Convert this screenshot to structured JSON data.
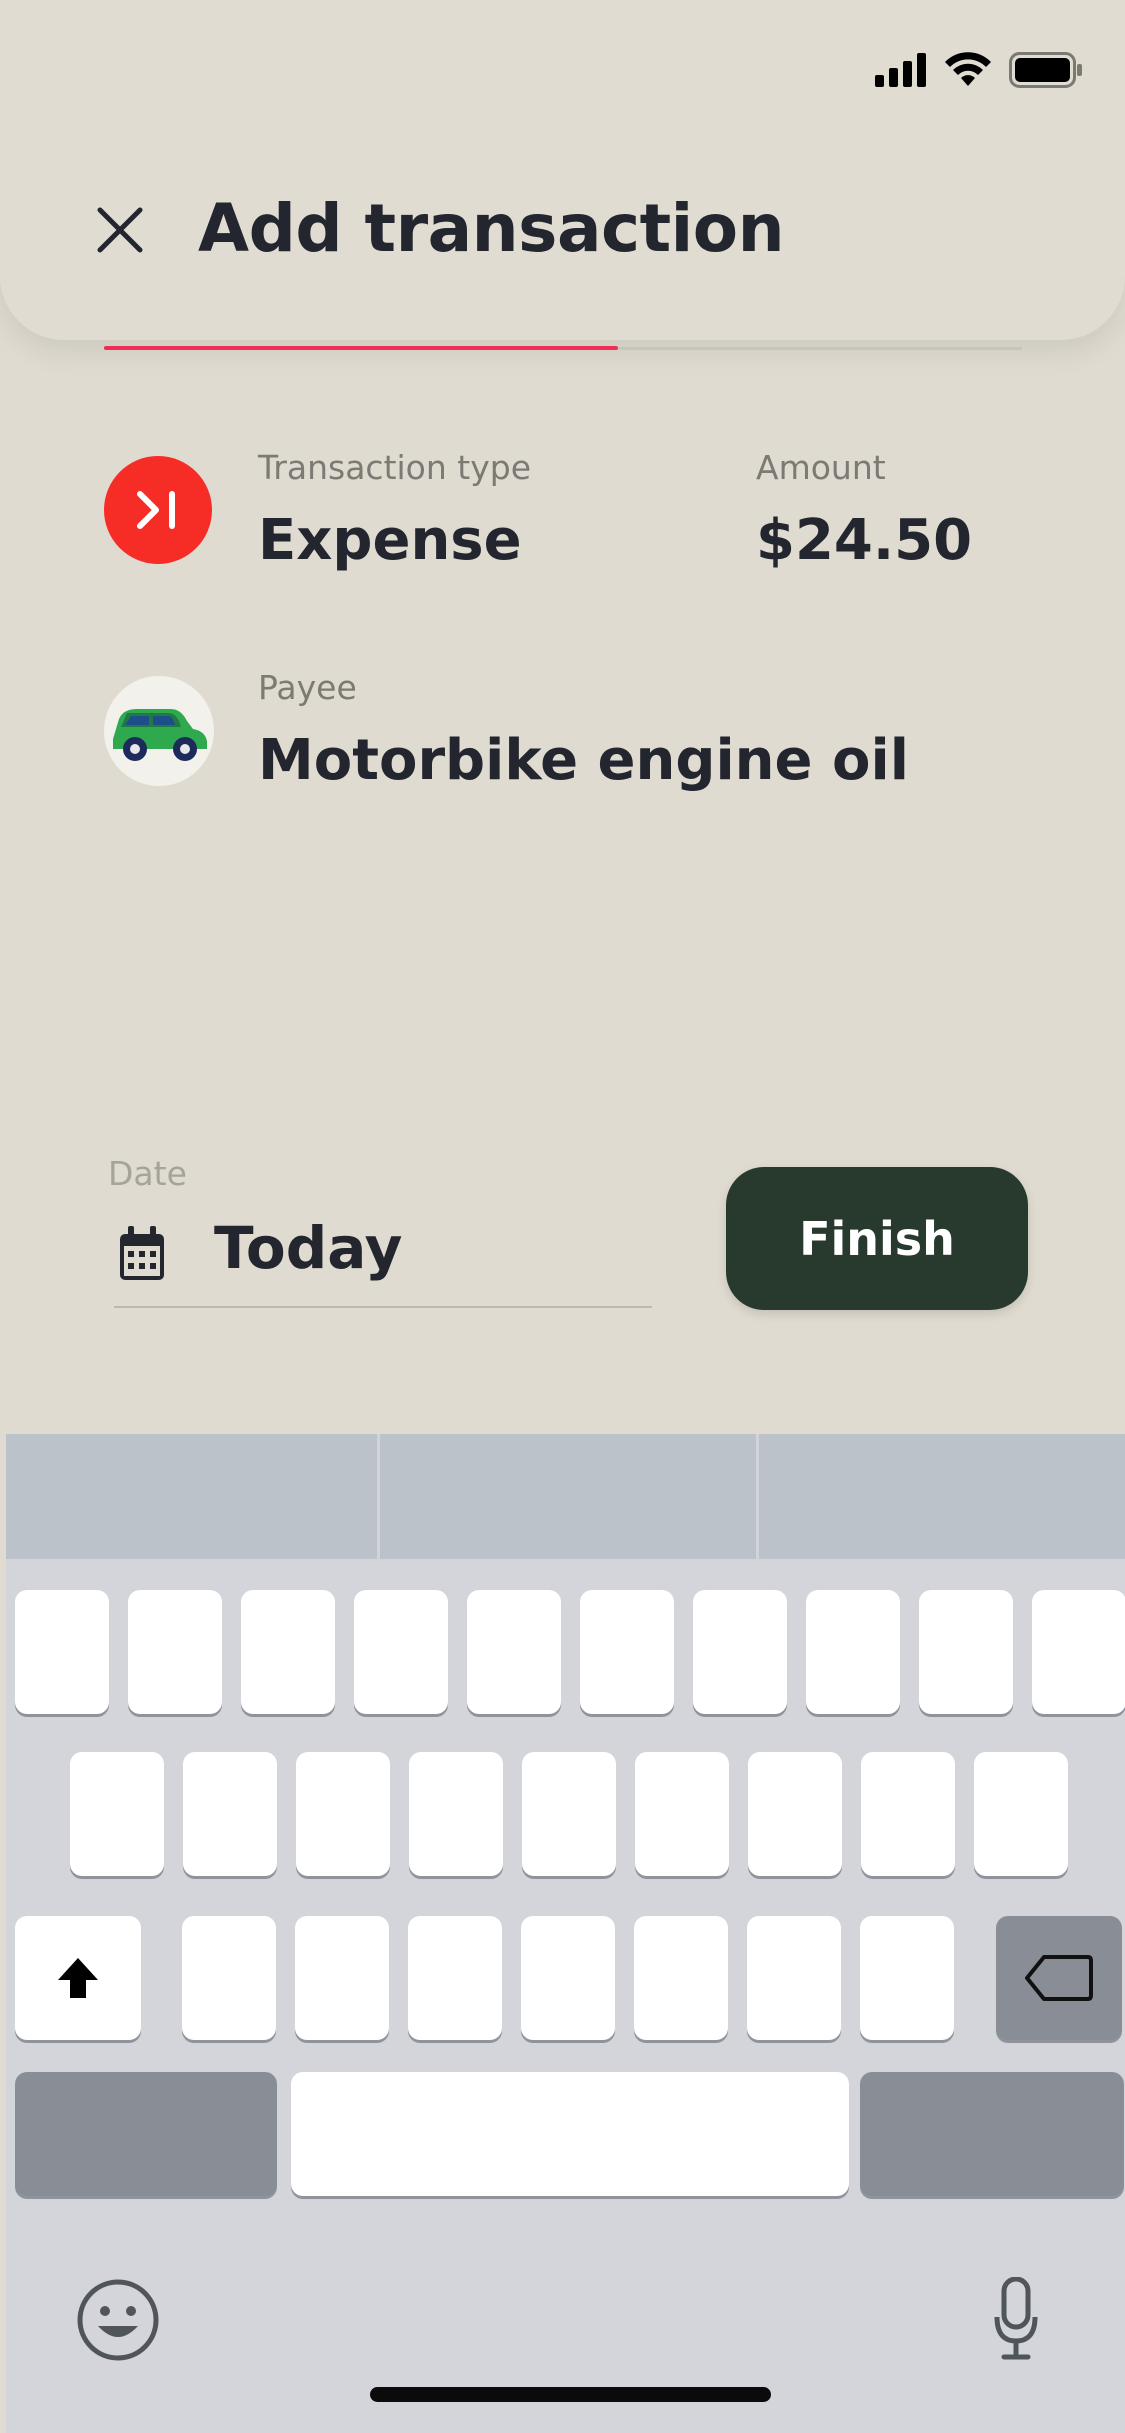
{
  "header": {
    "title": "Add transaction",
    "close_icon": "close-icon"
  },
  "progress": {
    "fraction": 0.56
  },
  "transaction_type": {
    "label": "Transaction type",
    "value": "Expense",
    "icon": "expense-arrow-icon",
    "icon_color": "#f62c27"
  },
  "amount": {
    "label": "Amount",
    "value": "$24.50"
  },
  "payee": {
    "label": "Payee",
    "value": "Motorbike engine oil",
    "icon": "car-icon"
  },
  "date": {
    "label": "Date",
    "value": "Today",
    "icon": "calendar-icon"
  },
  "finish_button": {
    "label": "Finish",
    "color": "#283a2e"
  },
  "accent_color": "#ef2d56"
}
